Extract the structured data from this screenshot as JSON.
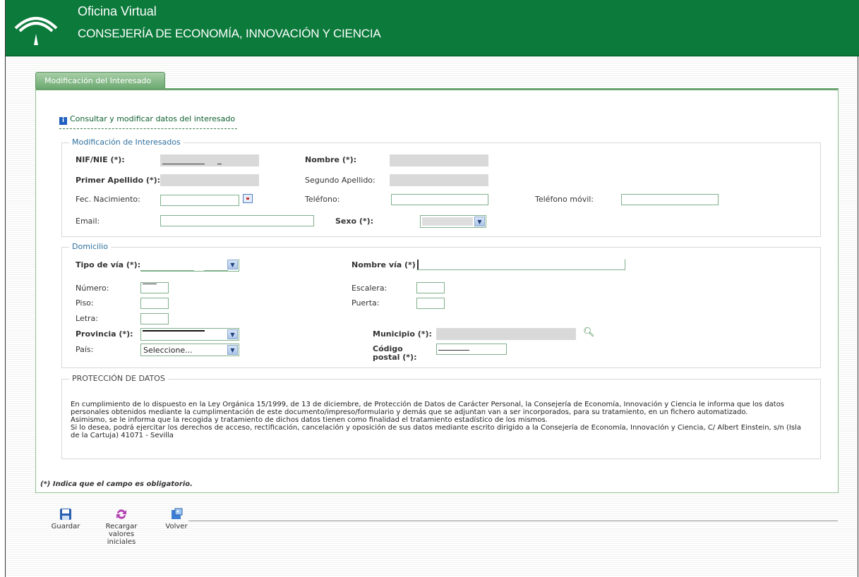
{
  "header": {
    "title": "Oficina Virtual",
    "subtitle": "CONSEJERÍA DE ECONOMÍA, INNOVACIÓN Y CIENCIA"
  },
  "tab": {
    "label": "Modificación del Interesado"
  },
  "info_link": "Consultar y modificar datos del interesado",
  "interesados": {
    "legend": "Modificación de Interesados",
    "nif_label": "NIF/NIE (*):",
    "nombre_label": "Nombre (*):",
    "primer_apellido_label": "Primer Apellido (*):",
    "segundo_apellido_label": "Segundo Apellido:",
    "fec_nacimiento_label": "Fec. Nacimiento:",
    "telefono_label": "Teléfono:",
    "telefono_movil_label": "Teléfono móvil:",
    "email_label": "Email:",
    "sexo_label": "Sexo (*):"
  },
  "domicilio": {
    "legend": "Domicilio",
    "tipo_via_label": "Tipo de vía (*):",
    "nombre_via_label": "Nombre vía (*):",
    "numero_label": "Número:",
    "escalera_label": "Escalera:",
    "piso_label": "Piso:",
    "puerta_label": "Puerta:",
    "letra_label": "Letra:",
    "provincia_label": "Provincia (*):",
    "municipio_label": "Municipio (*):",
    "pais_label": "País:",
    "pais_value": "Seleccione...",
    "codigo_postal_label": "Código postal (*):"
  },
  "proteccion": {
    "legend": "PROTECCIÓN DE DATOS",
    "p1": "En cumplimiento de lo dispuesto en la Ley Orgánica 15/1999, de 13 de diciembre, de Protección de Datos de Carácter Personal, la Consejería de Economía, Innovación y Ciencia le informa que los datos personales obtenidos mediante la cumplimentación de este documento/impreso/formulario y demás que se adjuntan van a ser incorporados, para su tratamiento, en un fichero automatizado.",
    "p2": "Asimismo, se le informa que la recogida y tratamiento de dichos datos tienen como finalidad el tratamiento estadístico de los mismos.",
    "p3": "Si lo desea, podrá ejercitar los derechos de acceso, rectificación, cancelación y oposición de sus datos mediante escrito dirigido a la Consejería de Economía, Innovación y Ciencia, C/ Albert Einstein, s/n (Isla de la Cartuja) 41071 - Sevilla"
  },
  "required_note": "(*) Indica que el campo es obligatorio.",
  "toolbar": {
    "guardar": "Guardar",
    "recargar": "Recargar valores iniciales",
    "volver": "Volver"
  },
  "icons": {
    "logo": "junta-andalucia-logo",
    "info": "info-icon",
    "calendar": "calendar-icon",
    "search": "magnifier-icon",
    "save": "floppy-disk-icon",
    "reload": "reload-icon",
    "back": "back-icon"
  },
  "colors": {
    "header_green": "#0b7a3b",
    "tab_green": "#6eaa72",
    "link": "#0e5e2f"
  }
}
